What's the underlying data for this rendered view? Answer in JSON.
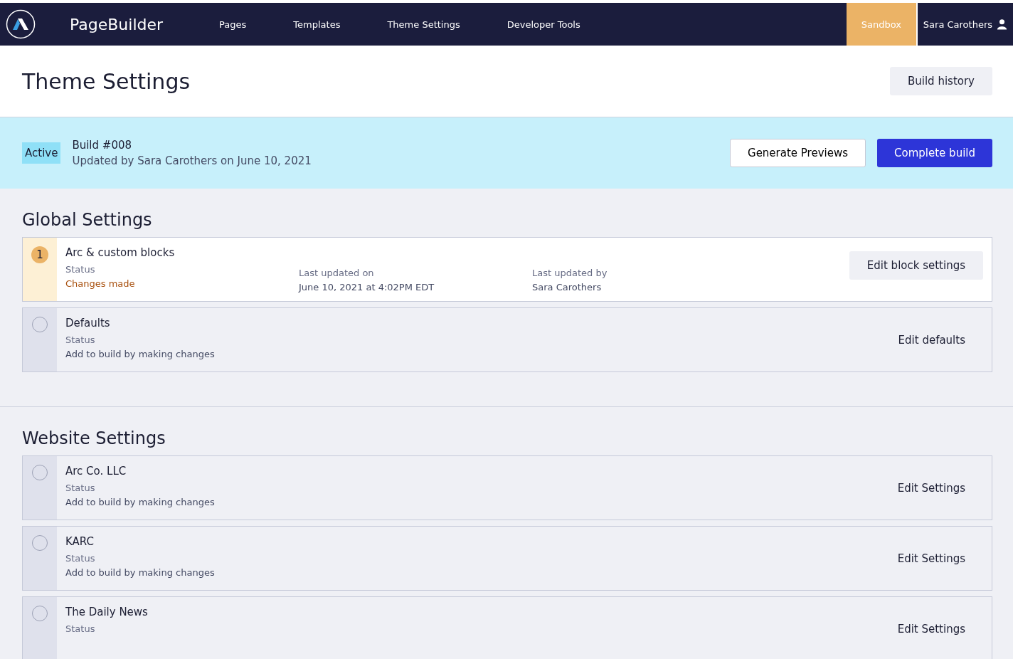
{
  "nav": {
    "brand": "PageBuilder",
    "links": [
      {
        "label": "Pages",
        "selected": false
      },
      {
        "label": "Templates",
        "selected": false
      },
      {
        "label": "Theme Settings",
        "selected": false
      },
      {
        "label": "Developer Tools",
        "selected": false
      }
    ],
    "environment": "Sandbox",
    "user": "Sara Carothers"
  },
  "header": {
    "title": "Theme Settings",
    "button": "Build history"
  },
  "build": {
    "badge": "Active",
    "title": "Build #008",
    "subtitle": "Updated by Sara Carothers on June 10, 2021",
    "buttons": [
      {
        "label": "Generate Previews",
        "kind": "secondary"
      },
      {
        "label": "Complete build",
        "kind": "primary"
      }
    ]
  },
  "sections": [
    {
      "title": "Global Settings",
      "items": [
        {
          "title": "Arc & custom blocks",
          "changed": true,
          "count": "1",
          "status_label": "Status",
          "status": "Changes made",
          "meta": [
            {
              "label": "Last updated on",
              "value": "June 10, 2021 at 4:02PM EDT"
            },
            {
              "label": "Last updated by",
              "value": "Sara Carothers"
            }
          ],
          "action": "Edit block settings"
        },
        {
          "title": "Defaults",
          "changed": false,
          "status_label": "Status",
          "status": "Add to build by making changes",
          "action": "Edit defaults"
        }
      ]
    },
    {
      "title": "Website Settings",
      "items": [
        {
          "title": "Arc Co. LLC",
          "changed": false,
          "status_label": "Status",
          "status": "Add to build by making changes",
          "action": "Edit Settings"
        },
        {
          "title": "KARC",
          "changed": false,
          "status_label": "Status",
          "status": "Add to build by making changes",
          "action": "Edit Settings"
        },
        {
          "title": "The Daily News",
          "changed": false,
          "status_label": "Status",
          "action": "Edit Settings"
        }
      ]
    }
  ]
}
